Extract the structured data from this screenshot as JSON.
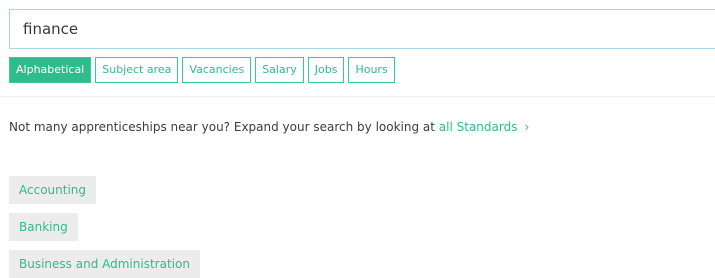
{
  "search": {
    "value": "finance"
  },
  "sort_tabs": [
    {
      "label": "Alphabetical",
      "active": true
    },
    {
      "label": "Subject area",
      "active": false
    },
    {
      "label": "Vacancies",
      "active": false
    },
    {
      "label": "Salary",
      "active": false
    },
    {
      "label": "Jobs",
      "active": false
    },
    {
      "label": "Hours",
      "active": false
    }
  ],
  "notice": {
    "text": "Not many apprenticeships near you? Expand your search by looking at ",
    "link_text": "all Standards",
    "chevron": "›"
  },
  "results": [
    {
      "label": "Accounting"
    },
    {
      "label": "Banking"
    },
    {
      "label": "Business and Administration"
    }
  ],
  "colors": {
    "accent": "#2fbc8c",
    "search_border": "#a9d6e8",
    "chip_background": "#ececec"
  }
}
